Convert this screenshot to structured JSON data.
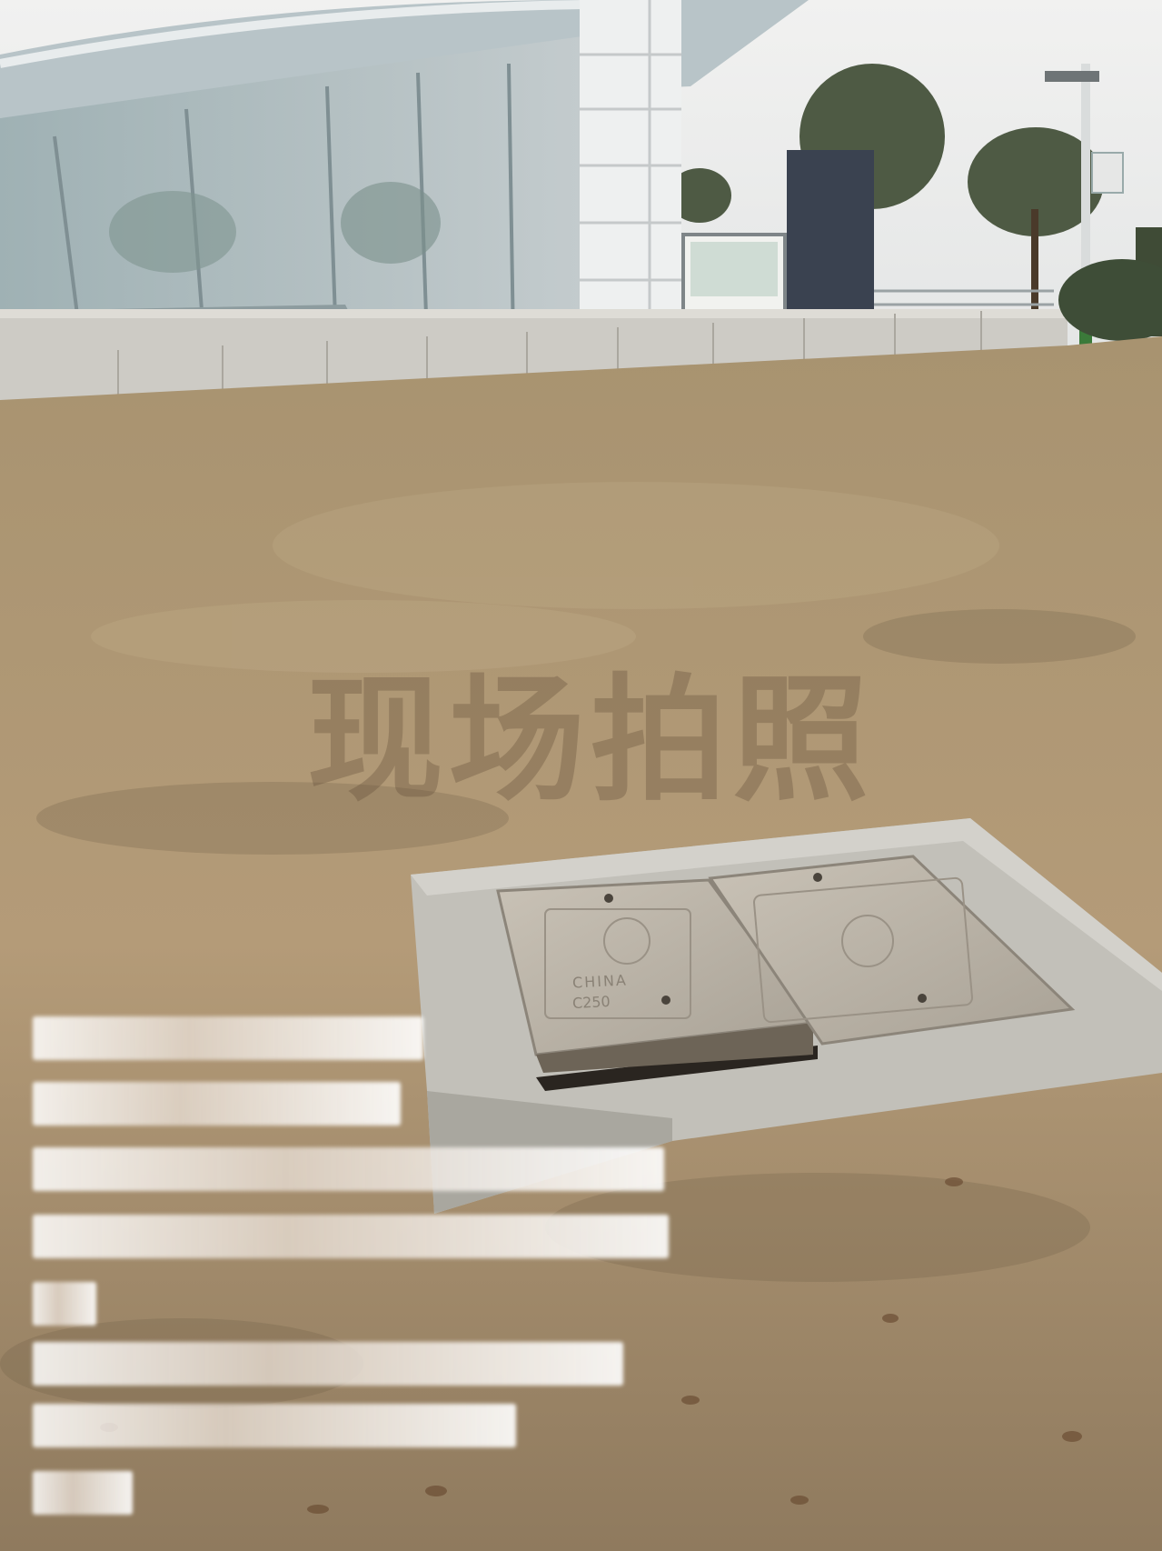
{
  "scene": {
    "palette": {
      "sky": "#e9eaea",
      "grass": "#b39a78",
      "glass": "#aeb9bd",
      "concrete": "#c5c3bd",
      "cover": "#bdb6aa"
    }
  },
  "watermark": {
    "text": "现场拍照"
  },
  "blurred_caption": {
    "line_count": 8
  },
  "cover_markings": {
    "word": "CHINA",
    "load_rating": "C250"
  }
}
